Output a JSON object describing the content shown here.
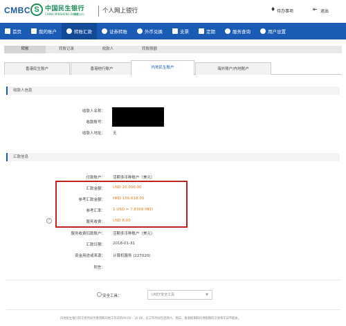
{
  "header": {
    "brand_en": "CMBC",
    "brand_cn": "中国民生银行",
    "brand_en_sub": "CHINA MINSHENG BANK",
    "brand_bank_sub": "香港分行",
    "title": "个人网上银行",
    "messages": "待办事项",
    "logout": "退出"
  },
  "nav": {
    "items": [
      {
        "label": "首页",
        "icon": "home-icon"
      },
      {
        "label": "我的账户",
        "icon": "account-icon"
      },
      {
        "label": "转账汇款",
        "icon": "transfer-icon"
      },
      {
        "label": "证券转账",
        "icon": "securities-icon"
      },
      {
        "label": "外币兑换",
        "icon": "fx-icon"
      },
      {
        "label": "支票",
        "icon": "cheque-icon"
      },
      {
        "label": "定期",
        "icon": "deposit-icon"
      },
      {
        "label": "服务查询",
        "icon": "search-icon"
      },
      {
        "label": "用户设置",
        "icon": "settings-icon"
      }
    ],
    "active_index": 2
  },
  "subtabs": [
    "转账",
    "转账记录",
    "收款人",
    "转账限额"
  ],
  "acctabs": [
    "香港民生账户",
    "香港他行账户",
    "内地民生账户",
    "海外账户/内地账户"
  ],
  "payee_section": {
    "title": "收款人信息",
    "name_label": "收款人名称：",
    "account_label": "收款账号：",
    "address_label": "收款人地址：",
    "address_value": "无"
  },
  "remit_section": {
    "title": "汇款信息",
    "rows": [
      {
        "label": "付款账户：",
        "value": "活期多币种账户（美元）",
        "highlight": false
      },
      {
        "label": "汇款金额：",
        "value": "USD 20,000.00",
        "highlight": true
      },
      {
        "label": "参考汇款金额：",
        "value": "HKD 156,618.00",
        "highlight": true
      },
      {
        "label": "参考汇率：",
        "value": "1 USD = 7.8309 HKD",
        "highlight": true
      },
      {
        "label": "服务收费：",
        "value": "USD 8.00",
        "highlight": true
      },
      {
        "label": "服务收费扣款账户：",
        "value": "活期多币种账户（美元）",
        "highlight": false
      },
      {
        "label": "汇款日期：",
        "value": "2018-01-31",
        "highlight": false
      },
      {
        "label": "资金用途或来源：",
        "value": "计算机服务 (227020)",
        "highlight": false
      },
      {
        "label": "附言：",
        "value": "",
        "highlight": false
      }
    ]
  },
  "security": {
    "label": "安全工具：",
    "selected": "UKEY安全工具"
  },
  "footer_note": "内地民生银行的交易时间为香港和内地工作日的09:00 - 16:00，在工作时间包括周六、周日、香港假期和内地假期的交易将次日不能执。",
  "colors": {
    "nav_bg": "#1a5bb5",
    "highlight_text": "#e57a1e",
    "highlight_border": "#c0201f",
    "brand_green": "#1b8f5a"
  }
}
